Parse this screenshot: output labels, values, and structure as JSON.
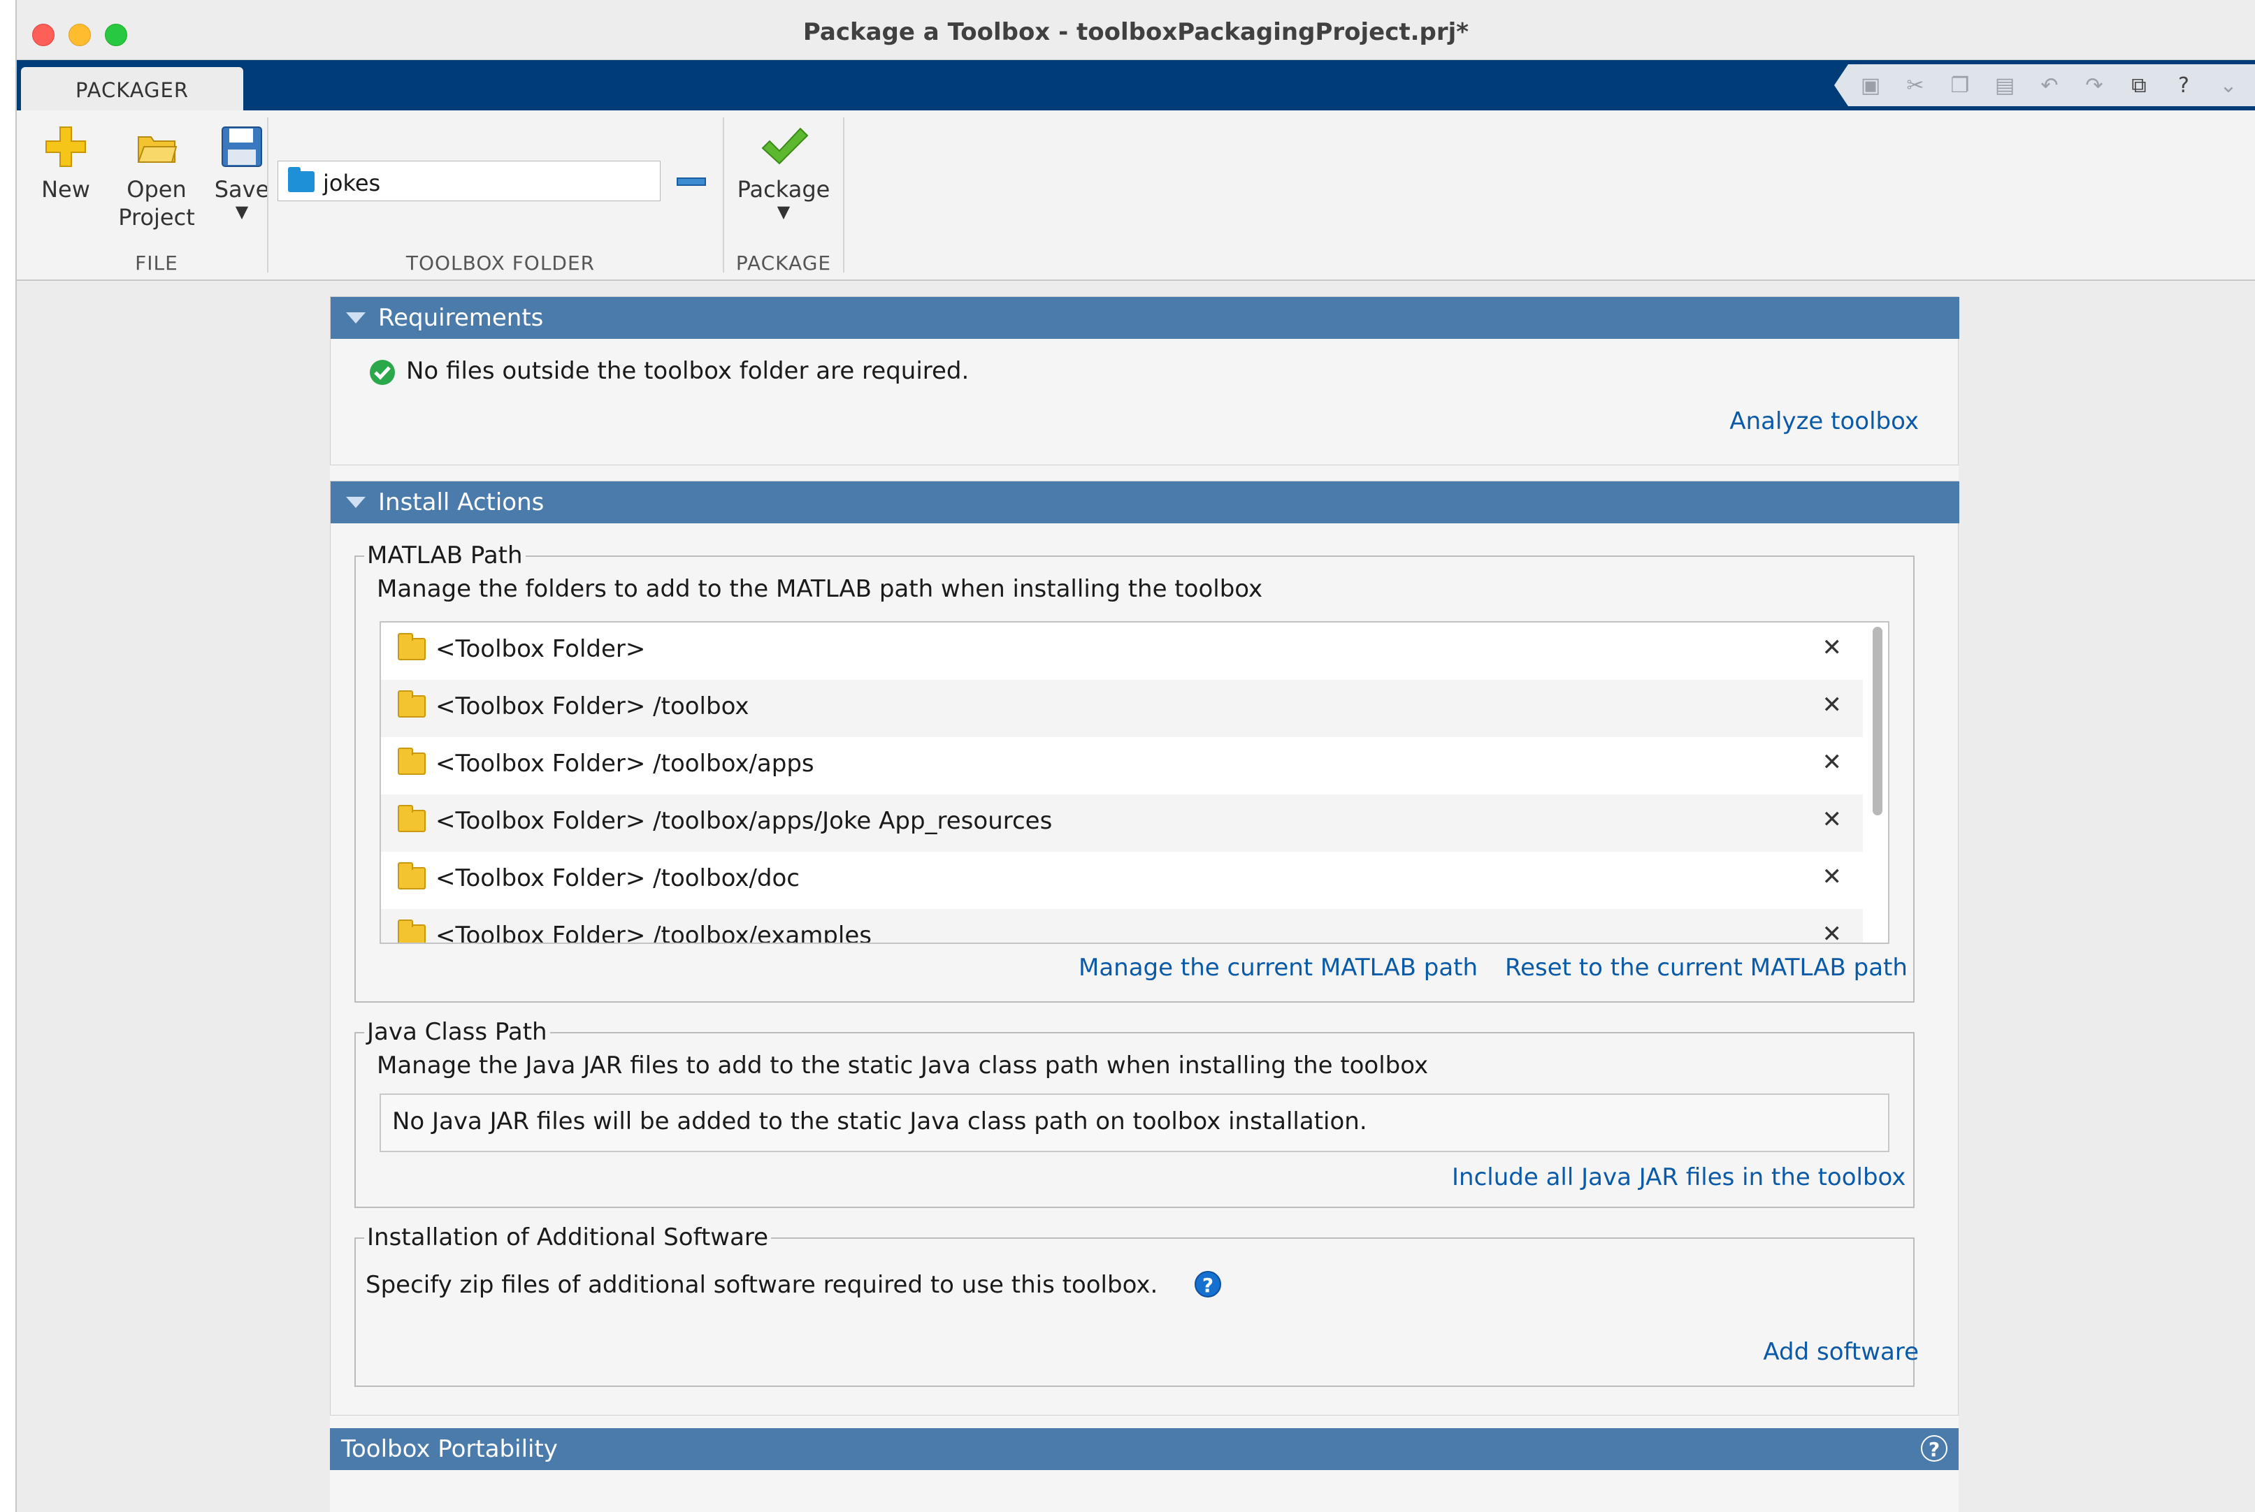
{
  "window": {
    "title": "Package a Toolbox - toolboxPackagingProject.prj*"
  },
  "tab": {
    "label": "PACKAGER"
  },
  "ribbon": {
    "new_label": "New",
    "open_label1": "Open",
    "open_label2": "Project",
    "save_label": "Save",
    "package_label": "Package",
    "group_file": "FILE",
    "group_toolbox_folder": "TOOLBOX FOLDER",
    "group_package": "PACKAGE",
    "toolbox_folder_value": "jokes"
  },
  "requirements": {
    "header": "Requirements",
    "status": "No files outside the toolbox folder are required.",
    "analyze_link": "Analyze toolbox"
  },
  "install_actions": {
    "header": "Install Actions",
    "matlab_path": {
      "legend": "MATLAB Path",
      "description": "Manage the folders to add to the MATLAB path when installing the toolbox",
      "folders": [
        "<Toolbox Folder>",
        "<Toolbox Folder> /toolbox",
        "<Toolbox Folder> /toolbox/apps",
        "<Toolbox Folder> /toolbox/apps/Joke App_resources",
        "<Toolbox Folder> /toolbox/doc",
        "<Toolbox Folder> /toolbox/examples"
      ],
      "manage_link": "Manage the current MATLAB path",
      "reset_link": "Reset to the current MATLAB path"
    },
    "java_class_path": {
      "legend": "Java Class Path",
      "description": "Manage the Java JAR files to add to the static Java class path when installing the toolbox",
      "status": "No Java JAR files will be added to the static Java class path on toolbox installation.",
      "include_link": "Include all Java JAR files in the toolbox"
    },
    "additional_software": {
      "legend": "Installation of Additional Software",
      "description": "Specify zip files of additional software required to use this toolbox.",
      "add_link": "Add software"
    }
  },
  "portability": {
    "header": "Toolbox Portability"
  },
  "colors": {
    "accent": "#003c78",
    "panel_header": "#4a7bab",
    "link": "#0a5aa8"
  }
}
